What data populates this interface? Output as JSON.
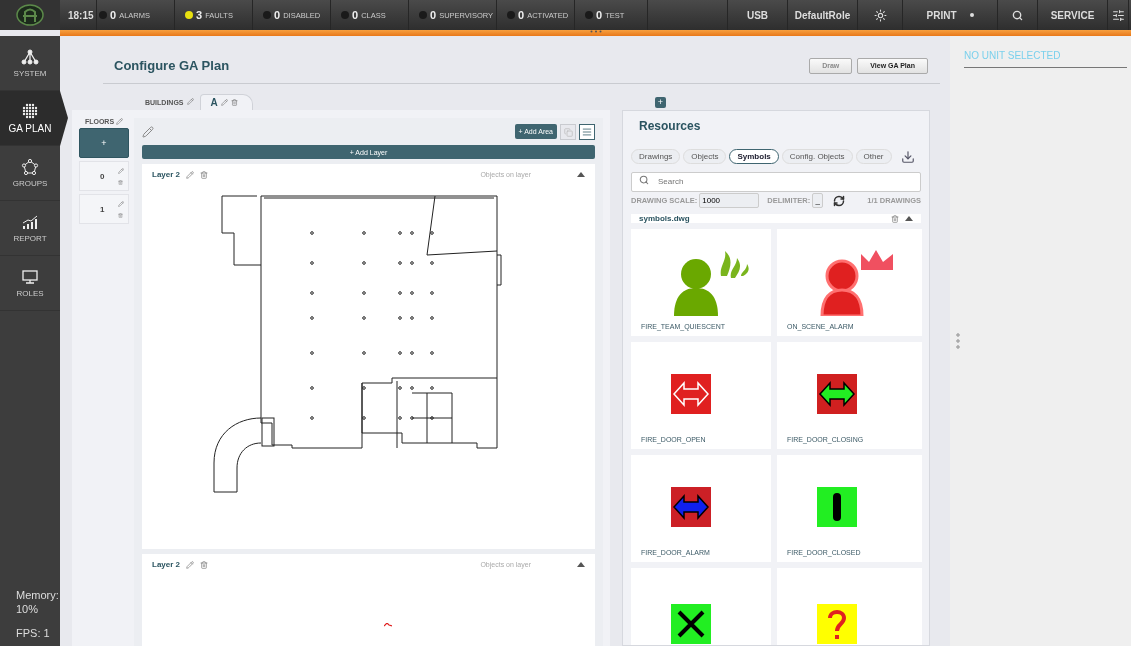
{
  "top_bar": {
    "time": "18:15",
    "statuses": [
      {
        "count": "0",
        "label": "ALARMS",
        "color": "#1a1a1a"
      },
      {
        "count": "3",
        "label": "FAULTS",
        "color": "#e8e010"
      },
      {
        "count": "0",
        "label": "DISABLED",
        "color": "#1a1a1a"
      },
      {
        "count": "0",
        "label": "CLASS",
        "color": "#1a1a1a"
      },
      {
        "count": "0",
        "label": "SUPERVISORY",
        "color": "#1a1a1a"
      },
      {
        "count": "0",
        "label": "ACTIVATED",
        "color": "#1a1a1a"
      },
      {
        "count": "0",
        "label": "TEST",
        "color": "#1a1a1a"
      }
    ],
    "usb": "USB",
    "role": "DefaultRole",
    "print": "PRINT",
    "service": "SERVICE"
  },
  "sidebar": {
    "items": [
      {
        "label": "SYSTEM",
        "kind": "network",
        "selected": false
      },
      {
        "label": "GA PLAN",
        "kind": "dots",
        "selected": true
      },
      {
        "label": "GROUPS",
        "kind": "ring",
        "selected": false
      },
      {
        "label": "REPORT",
        "kind": "chart",
        "selected": false
      },
      {
        "label": "ROLES",
        "kind": "monitor",
        "selected": false
      }
    ],
    "memory": "Memory: 10%",
    "fps": "FPS: 1"
  },
  "page": {
    "title": "Configure GA Plan",
    "buttons": [
      {
        "label": "Draw",
        "disabled": true
      },
      {
        "label": "View GA Plan",
        "disabled": false
      }
    ]
  },
  "buildings": {
    "label": "BUILDINGS",
    "tabs": [
      {
        "label": "A",
        "selected": true
      }
    ],
    "add": "+"
  },
  "floors": {
    "label": "FLOORS",
    "add": "+",
    "items": [
      {
        "label": "0"
      },
      {
        "label": "1"
      }
    ]
  },
  "layers": {
    "add_area": "+ Add Area",
    "add_layer": "+ Add Layer",
    "view_toggles": [
      {
        "kind": "grid",
        "selected": false
      },
      {
        "kind": "list",
        "selected": true
      }
    ],
    "items": [
      {
        "name": "Layer 2",
        "hint": "Objects on layer",
        "kind": "plan"
      },
      {
        "name": "Layer 2",
        "hint": "Objects on layer",
        "kind": "mark"
      }
    ]
  },
  "resources": {
    "title": "Resources",
    "tabs": [
      {
        "label": "Drawings",
        "selected": false
      },
      {
        "label": "Objects",
        "selected": false
      },
      {
        "label": "Symbols",
        "selected": true
      },
      {
        "label": "Config. Objects",
        "selected": false
      },
      {
        "label": "Other",
        "selected": false
      }
    ],
    "search": {
      "placeholder": "Search"
    },
    "scale_label": "DRAWING SCALE:",
    "scale": "1000",
    "delimiter_label": "DELIMITER:",
    "delimiter": "_",
    "count": "1/1 DRAWINGS",
    "file": "symbols.dwg",
    "symbols": [
      {
        "name": "FIRE_TEAM_QUIESCENT",
        "kind": "team"
      },
      {
        "name": "ON_SCENE_ALARM",
        "kind": "scene"
      },
      {
        "name": "FIRE_DOOR_OPEN",
        "kind": "door_open"
      },
      {
        "name": "FIRE_DOOR_CLOSING",
        "kind": "door_closing"
      },
      {
        "name": "FIRE_DOOR_ALARM",
        "kind": "door_alarm"
      },
      {
        "name": "FIRE_DOOR_CLOSED",
        "kind": "door_closed"
      },
      {
        "kind": "cross"
      },
      {
        "kind": "question"
      }
    ]
  },
  "unit_panel": {
    "title": "NO UNIT SELECTED"
  }
}
